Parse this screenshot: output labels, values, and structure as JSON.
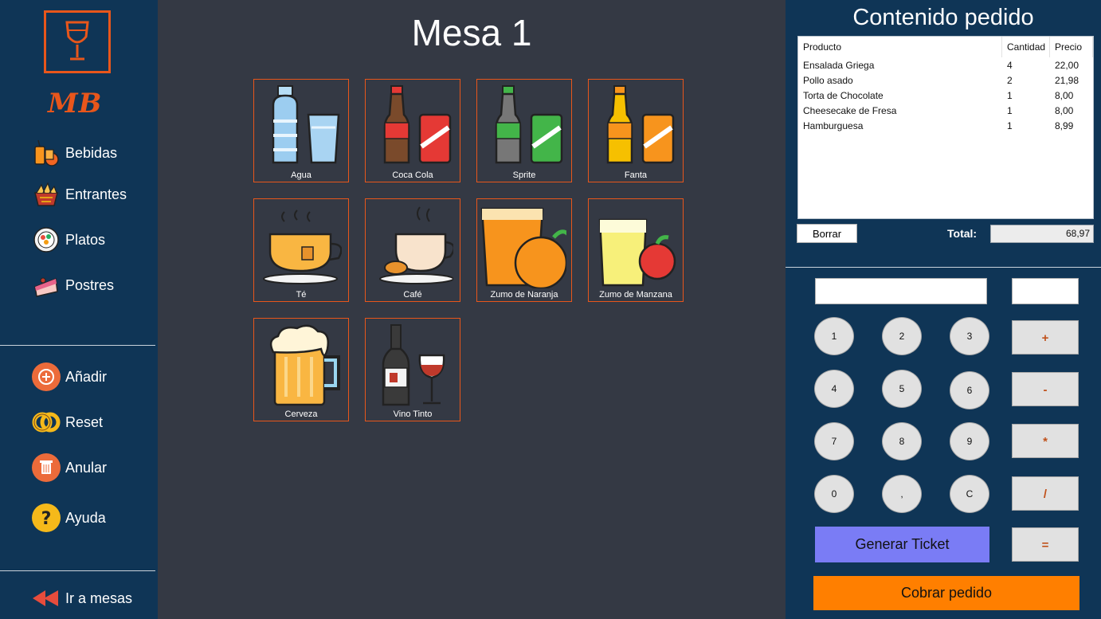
{
  "sidebar": {
    "logo_text": "MB",
    "categories": [
      {
        "label": "Bebidas",
        "icon": "drinks-icon"
      },
      {
        "label": "Entrantes",
        "icon": "nachos-icon"
      },
      {
        "label": "Platos",
        "icon": "plate-icon"
      },
      {
        "label": "Postres",
        "icon": "cake-icon"
      }
    ],
    "actions": [
      {
        "label": "Añadir",
        "icon": "add-icon"
      },
      {
        "label": "Reset",
        "icon": "reset-icon"
      },
      {
        "label": "Anular",
        "icon": "trash-icon"
      },
      {
        "label": "Ayuda",
        "icon": "help-icon"
      }
    ],
    "back_label": "Ir a mesas"
  },
  "main": {
    "title": "Mesa 1",
    "products": [
      {
        "label": "Agua",
        "icon": "water-bottle-icon"
      },
      {
        "label": "Coca Cola",
        "icon": "cola-icon"
      },
      {
        "label": "Sprite",
        "icon": "sprite-icon"
      },
      {
        "label": "Fanta",
        "icon": "fanta-icon"
      },
      {
        "label": "Té",
        "icon": "tea-icon"
      },
      {
        "label": "Café",
        "icon": "coffee-icon"
      },
      {
        "label": "Zumo de Naranja",
        "icon": "orange-juice-icon"
      },
      {
        "label": "Zumo de Manzana",
        "icon": "apple-juice-icon"
      },
      {
        "label": "Cerveza",
        "icon": "beer-icon"
      },
      {
        "label": "Vino Tinto",
        "icon": "wine-icon"
      }
    ]
  },
  "order": {
    "title": "Contenido pedido",
    "columns": [
      "Producto",
      "Cantidad",
      "Precio"
    ],
    "rows": [
      [
        "Ensalada Griega",
        "4",
        "22,00"
      ],
      [
        "Pollo asado",
        "2",
        "21,98"
      ],
      [
        "Torta de Chocolate",
        "1",
        "8,00"
      ],
      [
        "Cheesecake de Fresa",
        "1",
        "8,00"
      ],
      [
        "Hamburguesa",
        "1",
        "8,99"
      ]
    ],
    "delete_label": "Borrar",
    "total_label": "Total:",
    "total_value": "68,97"
  },
  "calculator": {
    "keys": [
      "1",
      "2",
      "3",
      "4",
      "5",
      "6",
      "7",
      "8",
      "9",
      "0",
      ",",
      "C"
    ],
    "operators": [
      "+",
      "-",
      "*",
      "/",
      "="
    ],
    "ticket_label": "Generar Ticket",
    "charge_label": "Cobrar pedido"
  },
  "colors": {
    "accent": "#e8561b",
    "panel": "#0f3556",
    "background": "#343944",
    "ticket": "#7a7cf5",
    "charge": "#ff7f00"
  }
}
